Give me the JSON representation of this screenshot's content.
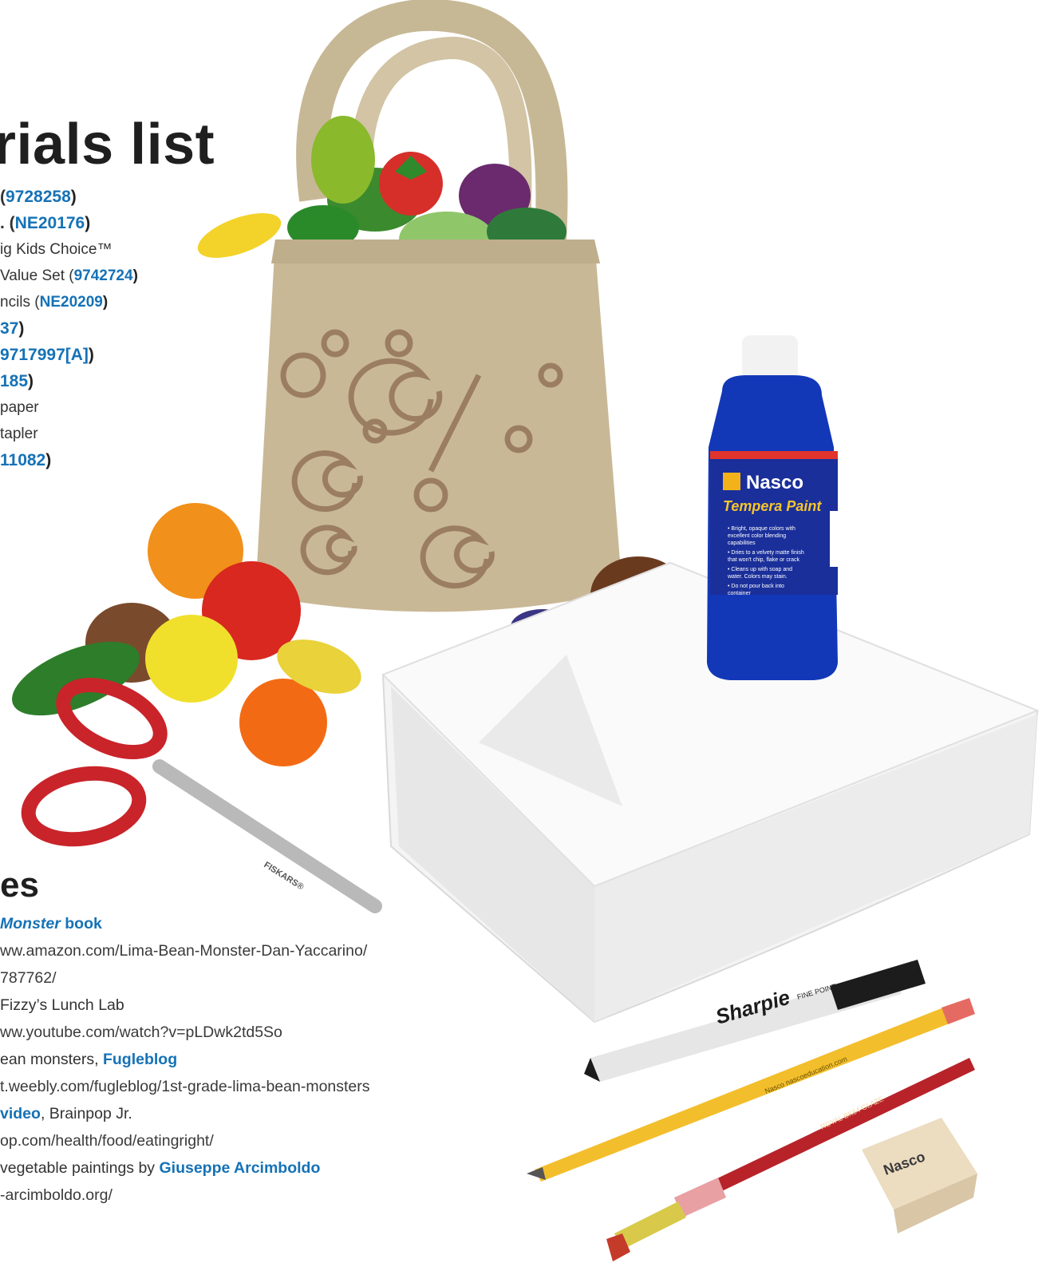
{
  "page_title": "rials list",
  "materials": [
    {
      "pre": "(",
      "code": "9728258",
      "post": ")",
      "big": true
    },
    {
      "pre": ". (",
      "code": "NE20176",
      "post": ")",
      "big": true
    },
    {
      "pre": "ig Kids Choice™",
      "code": "",
      "post": "",
      "big": false
    },
    {
      "pre": "Value Set (",
      "code": "9742724",
      "post": ")",
      "big": false
    },
    {
      "pre": "ncils (",
      "code": "NE20209",
      "post": ")",
      "big": false
    },
    {
      "pre": "",
      "code": "37",
      "post": ")",
      "big": true
    },
    {
      "pre": "",
      "code": "9717997[A]",
      "post": ")",
      "big": true
    },
    {
      "pre": "",
      "code": "185",
      "post": ")",
      "big": true
    },
    {
      "pre": "paper",
      "code": "",
      "post": "",
      "big": false
    },
    {
      "pre": "tapler",
      "code": "",
      "post": "",
      "big": false
    },
    {
      "pre": "",
      "code": "11082",
      "post": ")",
      "big": true
    }
  ],
  "resources_title": "es",
  "resources": [
    {
      "a": "",
      "link_italic": "Monster",
      "link": " book",
      "b": ""
    },
    {
      "a": "ww.amazon.com/Lima-Bean-Monster-Dan-Yaccarino/",
      "link_italic": "",
      "link": "",
      "b": ""
    },
    {
      "a": "787762/",
      "link_italic": "",
      "link": "",
      "b": ""
    },
    {
      "a": "  Fizzy’s Lunch Lab",
      "link_italic": "",
      "link": "",
      "b": ""
    },
    {
      "a": "ww.youtube.com/watch?v=pLDwk2td5So",
      "link_italic": "",
      "link": "",
      "b": ""
    },
    {
      "a": "ean monsters, ",
      "link_italic": "",
      "link": "Fugleblog",
      "b": ""
    },
    {
      "a": "t.weebly.com/fugleblog/1st-grade-lima-bean-monsters",
      "link_italic": "",
      "link": "",
      "b": ""
    },
    {
      "a": "",
      "link_italic": "",
      "link": "video",
      "b": ",  Brainpop Jr."
    },
    {
      "a": "op.com/health/food/eatingright/",
      "link_italic": "",
      "link": "",
      "b": ""
    },
    {
      "a": "  vegetable paintings by ",
      "link_italic": "",
      "link": "Giuseppe Arcimboldo",
      "b": ""
    },
    {
      "a": "-arcimboldo.org/",
      "link_italic": "",
      "link": "",
      "b": ""
    }
  ],
  "product_labels": {
    "paint_brand": "Nasco",
    "paint_name": "Tempera Paint",
    "paint_bullets": [
      "• Bright, opaque colors with",
      "  excellent color blending",
      "  capabilities",
      "• Dries to a velvety matte finish",
      "  that won't chip, flake or crack",
      "• Cleans up with soap and",
      "  water. Colors may stain.",
      "• Do not pour back into",
      "  container"
    ],
    "scissors_brand": "FISKARS®",
    "marker_brand": "Sharpie",
    "marker_sub": "FINE POINT",
    "pencil_brand": "Nasco  nascoeducation.com",
    "brush_brand": "ROYAL BK64 GLAZE",
    "eraser_brand": "Nasco"
  },
  "colors": {
    "accent_blue": "#1572b6",
    "bag": "#c9b896",
    "bag_print": "#9b7e62",
    "paint_blue": "#1238b8"
  }
}
